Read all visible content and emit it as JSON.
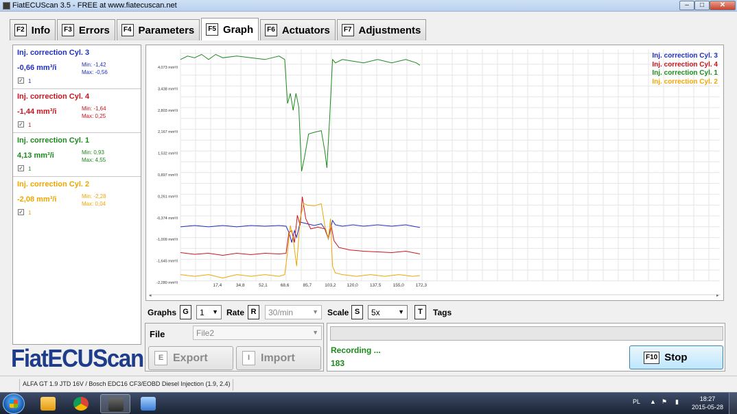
{
  "window": {
    "title": "FiatECUScan 3.5 - FREE at www.fiatecuscan.net",
    "minimize": "–",
    "maximize": "□",
    "close": "✕"
  },
  "tabs": [
    {
      "key": "F2",
      "label": "Info"
    },
    {
      "key": "F3",
      "label": "Errors"
    },
    {
      "key": "F4",
      "label": "Parameters"
    },
    {
      "key": "F5",
      "label": "Graph",
      "active": true
    },
    {
      "key": "F6",
      "label": "Actuators"
    },
    {
      "key": "F7",
      "label": "Adjustments"
    }
  ],
  "channels": [
    {
      "name": "Inj. correction Cyl. 3",
      "value": "-0,66 mm³/i",
      "min": "Min: -1,42",
      "max": "Max: -0,56",
      "checked": "✓",
      "index": "1",
      "color": "#1f2fbf"
    },
    {
      "name": "Inj. correction Cyl. 4",
      "value": "-1,44 mm³/i",
      "min": "Min: -1,64",
      "max": "Max: 0,25",
      "checked": "✓",
      "index": "1",
      "color": "#c8141e"
    },
    {
      "name": "Inj. correction Cyl. 1",
      "value": "4,13 mm³/i",
      "min": "Min: 0,93",
      "max": "Max: 4,55",
      "checked": "✓",
      "index": "1",
      "color": "#1a8a1a"
    },
    {
      "name": "Inj. correction Cyl. 2",
      "value": "-2,08 mm³/i",
      "min": "Min: -2,28",
      "max": "Max: 0,04",
      "checked": "✓",
      "index": "1",
      "color": "#f0a500"
    }
  ],
  "chart_data": {
    "type": "line",
    "y_ticks": [
      "4,073 mm³/i",
      "3,438 mm³/i",
      "2,803 mm³/i",
      "2,167 mm³/i",
      "1,532 mm³/i",
      "0,897 mm³/i",
      "0,261 mm³/i",
      "-0,374 mm³/i",
      "-1,009 mm³/i",
      "-1,645 mm³/i",
      "-2,280 mm³/i"
    ],
    "y_tick_values": [
      4.073,
      3.438,
      2.803,
      2.167,
      1.532,
      0.897,
      0.261,
      -0.374,
      -1.009,
      -1.645,
      -2.28
    ],
    "x_ticks": [
      "17,4",
      "34,8",
      "52,1",
      "68,6",
      "85,7",
      "103,2",
      "120,0",
      "137,5",
      "155,0",
      "172,3"
    ],
    "x_tick_values": [
      17.4,
      34.8,
      52.1,
      68.6,
      85.7,
      103.2,
      120.0,
      137.5,
      155.0,
      172.3
    ],
    "xlim": [
      0,
      575
    ],
    "ylim": [
      -2.28,
      4.55
    ],
    "legend": "top-right",
    "grid": true,
    "series": [
      {
        "name": "Inj. correction Cyl. 3",
        "color": "#1f2fbf",
        "x": [
          0,
          20,
          40,
          60,
          80,
          100,
          120,
          140,
          150,
          155,
          158,
          162,
          165,
          170,
          180,
          190,
          200,
          205,
          210,
          213,
          216,
          220,
          230,
          245,
          260,
          280,
          300,
          320,
          340
        ],
        "y": [
          -0.64,
          -0.6,
          -0.64,
          -0.6,
          -0.64,
          -0.6,
          -0.62,
          -0.6,
          -0.62,
          -0.85,
          -1.1,
          -0.75,
          -0.95,
          -0.5,
          -0.55,
          -0.6,
          -0.55,
          -0.7,
          -1.0,
          -0.7,
          -0.45,
          -0.58,
          -0.62,
          -0.58,
          -0.62,
          -0.58,
          -0.62,
          -0.58,
          -0.66
        ]
      },
      {
        "name": "Inj. correction Cyl. 4",
        "color": "#c8141e",
        "x": [
          0,
          20,
          40,
          60,
          80,
          100,
          120,
          140,
          150,
          154,
          158,
          162,
          166,
          170,
          173,
          178,
          185,
          195,
          205,
          210,
          214,
          218,
          225,
          240,
          260,
          280,
          300,
          320,
          340
        ],
        "y": [
          -1.4,
          -1.45,
          -1.42,
          -1.48,
          -1.42,
          -1.46,
          -1.42,
          -1.44,
          -1.42,
          -0.8,
          -0.75,
          -1.1,
          -0.3,
          -0.6,
          0.25,
          -0.4,
          -0.7,
          -0.65,
          -0.7,
          -0.95,
          -0.6,
          -1.05,
          -1.25,
          -1.32,
          -1.36,
          -1.38,
          -1.4,
          -1.36,
          -1.44
        ]
      },
      {
        "name": "Inj. correction Cyl. 1",
        "color": "#1a8a1a",
        "x": [
          0,
          10,
          20,
          30,
          40,
          50,
          60,
          80,
          100,
          120,
          140,
          148,
          152,
          156,
          160,
          164,
          168,
          172,
          176,
          182,
          190,
          200,
          205,
          208,
          212,
          216,
          220,
          230,
          245,
          260,
          280,
          300,
          320,
          335,
          340
        ],
        "y": [
          4.3,
          4.4,
          4.35,
          4.45,
          4.3,
          4.45,
          4.35,
          4.4,
          4.35,
          4.3,
          4.4,
          4.3,
          3.0,
          3.3,
          2.8,
          3.3,
          2.9,
          1.0,
          1.4,
          2.1,
          2.15,
          2.2,
          1.6,
          1.1,
          2.6,
          4.3,
          4.2,
          4.3,
          4.25,
          4.2,
          4.3,
          4.2,
          4.3,
          4.2,
          4.13
        ]
      },
      {
        "name": "Inj. correction Cyl. 2",
        "color": "#f0a500",
        "x": [
          0,
          20,
          40,
          60,
          80,
          100,
          120,
          140,
          148,
          152,
          156,
          160,
          165,
          170,
          175,
          180,
          190,
          200,
          205,
          210,
          213,
          216,
          220,
          230,
          250,
          270,
          290,
          310,
          330,
          340
        ],
        "y": [
          -2.05,
          -2.1,
          -2.05,
          -2.15,
          -2.05,
          -2.1,
          -2.05,
          -2.1,
          -2.05,
          -1.4,
          -0.6,
          -1.0,
          -1.8,
          -0.4,
          0.05,
          0.0,
          -0.02,
          0.04,
          -0.6,
          -1.0,
          -0.4,
          -1.8,
          -2.0,
          -2.05,
          -2.1,
          -2.05,
          -2.1,
          -2.05,
          -2.1,
          -2.08
        ]
      }
    ]
  },
  "controls": {
    "graphs_label": "Graphs",
    "graphs_key": "G",
    "graphs_value": "1",
    "rate_label": "Rate",
    "rate_key": "R",
    "rate_value": "30/min",
    "scale_label": "Scale",
    "scale_key": "S",
    "scale_value": "5x",
    "tags_key": "T",
    "tags_label": "Tags"
  },
  "file": {
    "label": "File",
    "value": "File2",
    "export_key": "E",
    "export_label": "Export",
    "import_key": "I",
    "import_label": "Import"
  },
  "status": {
    "text": "Recording ...",
    "count": "183",
    "stop_key": "F10",
    "stop_label": "Stop"
  },
  "logo": "FiatECUScan",
  "footer": {
    "vehicle": "ALFA GT 1.9 JTD 16V / Bosch EDC16 CF3/EOBD Diesel Injection (1.9, 2.4)"
  },
  "taskbar": {
    "lang": "PL",
    "time": "18:27",
    "date": "2015-05-28"
  }
}
